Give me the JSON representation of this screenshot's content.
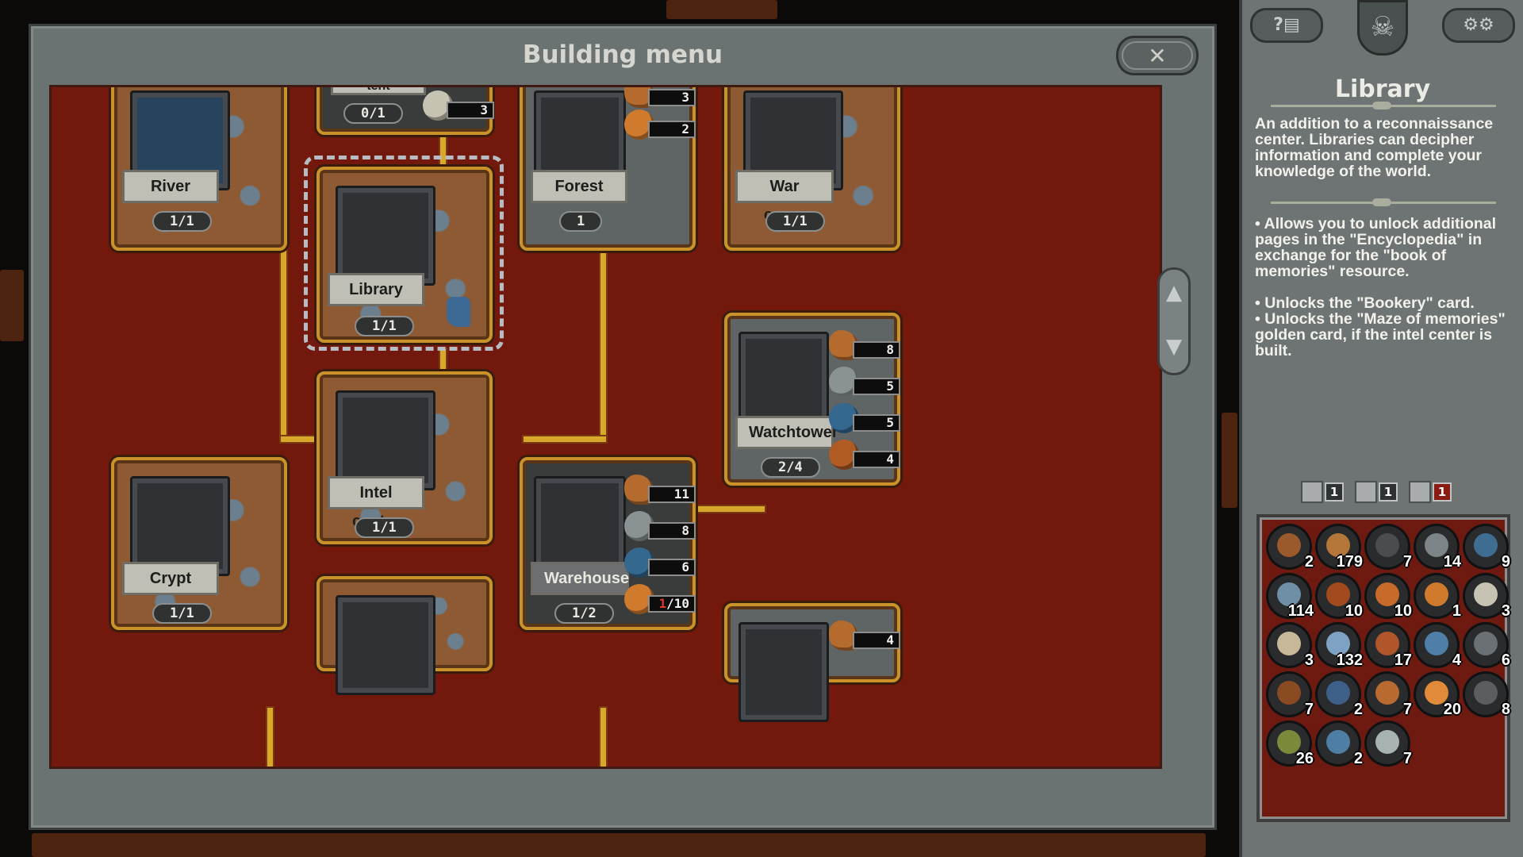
{
  "menu": {
    "title": "Building menu",
    "close_icon": "crossed-swords-icon",
    "scroll_up": "▲",
    "scroll_down": "▼"
  },
  "cards": {
    "river": {
      "label": "River",
      "count": "1/1"
    },
    "tent": {
      "label": "tent",
      "count": "0/1",
      "req": [
        "3"
      ]
    },
    "forest": {
      "label": "Forest",
      "count": "1",
      "req": [
        "3",
        "2"
      ]
    },
    "war_camp": {
      "label": "War camp",
      "count": "1/1"
    },
    "library": {
      "label": "Library",
      "count": "1/1"
    },
    "watchtower": {
      "label": "Watchtower",
      "count": "2/4",
      "req": [
        "8",
        "5",
        "5",
        "4"
      ]
    },
    "intel_center": {
      "label": "Intel center",
      "count": "1/1"
    },
    "crypt": {
      "label": "Crypt",
      "count": "1/1"
    },
    "warehouse": {
      "label": "Warehouse",
      "count": "1/2",
      "req": [
        "11",
        "8",
        "6"
      ],
      "req_partial": {
        "have": "1",
        "need": "/10"
      }
    },
    "bottom_right": {
      "req": [
        "4"
      ]
    }
  },
  "info": {
    "help_icon": "help-encyclopedia-icon",
    "settings_icon": "gear-icon",
    "emblem_icon": "skull-emblem-icon",
    "title": "Library",
    "description": "An addition to a reconnaissance center. Libraries can decipher information and complete your knowledge of the world.",
    "bullet1": "• Allows you to unlock additional pages in the \"Encyclopedia\" in exchange for the \"book of memories\" resource.",
    "bullet2": "• Unlocks the \"Bookery\" card.",
    "bullet3": "• Unlocks the \"Maze of memories\" golden card, if the intel center is built."
  },
  "inventory_tabs": [
    {
      "icon": "building-icon",
      "count": "1"
    },
    {
      "icon": "creature-icon",
      "count": "1"
    },
    {
      "icon": "tile-icon",
      "count": "1"
    }
  ],
  "inventory": [
    {
      "q": "2",
      "color": "#9b5a2c"
    },
    {
      "q": "179",
      "color": "#b5763a"
    },
    {
      "q": "7",
      "color": "#4a4d50"
    },
    {
      "q": "14",
      "color": "#7c8487"
    },
    {
      "q": "9",
      "color": "#3f6d92"
    },
    {
      "q": "114",
      "color": "#6f8fa6"
    },
    {
      "q": "10",
      "color": "#a24a1e"
    },
    {
      "q": "10",
      "color": "#c86a2a"
    },
    {
      "q": "1",
      "color": "#d07a2e"
    },
    {
      "q": "3",
      "color": "#c7c3b3"
    },
    {
      "q": "3",
      "color": "#c8b89a"
    },
    {
      "q": "132",
      "color": "#7fa2c4"
    },
    {
      "q": "17",
      "color": "#b0562a"
    },
    {
      "q": "4",
      "color": "#4f7fa8"
    },
    {
      "q": "6",
      "color": "#6a7074"
    },
    {
      "q": "7",
      "color": "#8a4a22"
    },
    {
      "q": "2",
      "color": "#3e6088"
    },
    {
      "q": "7",
      "color": "#b86a30"
    },
    {
      "q": "20",
      "color": "#e08a3a"
    },
    {
      "q": "8",
      "color": "#5b5e60"
    },
    {
      "q": "26",
      "color": "#7a8a3a"
    },
    {
      "q": "2",
      "color": "#4e7ea4"
    },
    {
      "q": "7",
      "color": "#a7b3b0"
    }
  ]
}
